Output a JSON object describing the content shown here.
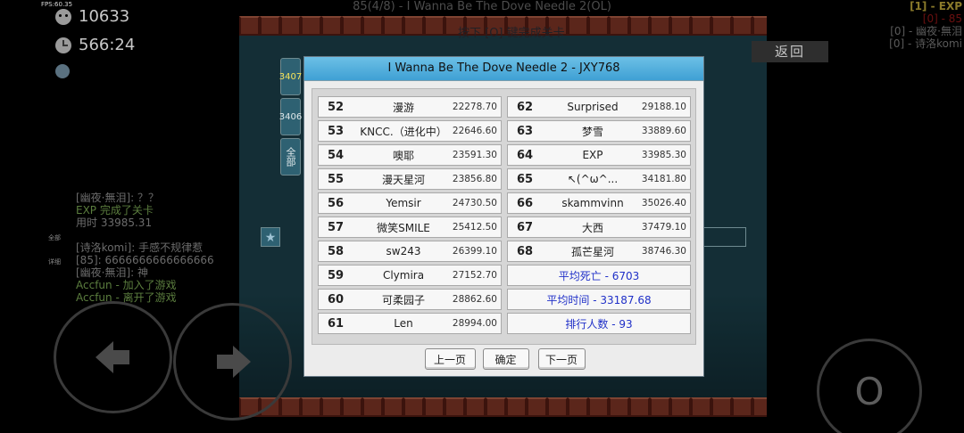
{
  "hud": {
    "fps": "FPS:60.35",
    "deaths": "10633",
    "time": "566:24"
  },
  "top_title": "85(4/8) - I Wanna Be The Dove Needle 2(OL)",
  "world_hint": "按下 [O] 键完成关卡",
  "right_list": [
    "[1] - EXP",
    "[0] - 85",
    "[0] - 幽夜·無泪",
    "[0] - 诗洛komi"
  ],
  "back_button": "返回",
  "chat": {
    "lines_a": [
      "[幽夜·無泪]: ？？",
      "EXP 完成了关卡",
      "用时 33985.31"
    ],
    "lines_b": [
      "[诗洛komi]: 手感不规律惹",
      "[85]: 6666666666666666",
      "[幽夜·無泪]: 神",
      "Accfun - 加入了游戏",
      "Accfun - 离开了游戏"
    ],
    "tag_all": "全部",
    "tag_detail": "详细"
  },
  "side_tabs": [
    "3407",
    "3406",
    "全部"
  ],
  "dialog": {
    "title": "I Wanna Be The Dove Needle 2 - JXY768",
    "left_rows": [
      {
        "rank": "52",
        "name": "漫游",
        "time": "22278.70"
      },
      {
        "rank": "53",
        "name": "KNCC.（进化中）",
        "time": "22646.60"
      },
      {
        "rank": "54",
        "name": "噢耶",
        "time": "23591.30"
      },
      {
        "rank": "55",
        "name": "漫天星河",
        "time": "23856.80"
      },
      {
        "rank": "56",
        "name": "Yemsir",
        "time": "24730.50"
      },
      {
        "rank": "57",
        "name": "微笑SMILE",
        "time": "25412.50"
      },
      {
        "rank": "58",
        "name": "sw243",
        "time": "26399.10"
      },
      {
        "rank": "59",
        "name": "Clymira",
        "time": "27152.70"
      },
      {
        "rank": "60",
        "name": "可柔园子",
        "time": "28862.60"
      },
      {
        "rank": "61",
        "name": "Len",
        "time": "28994.00"
      }
    ],
    "right_rows": [
      {
        "rank": "62",
        "name": "Surprised",
        "time": "29188.10"
      },
      {
        "rank": "63",
        "name": "梦雪",
        "time": "33889.60"
      },
      {
        "rank": "64",
        "name": "EXP",
        "time": "33985.30"
      },
      {
        "rank": "65",
        "name": "↖(^ω^...",
        "time": "34181.80"
      },
      {
        "rank": "66",
        "name": "skammvinn",
        "time": "35026.40"
      },
      {
        "rank": "67",
        "name": "大西",
        "time": "37479.10"
      },
      {
        "rank": "68",
        "name": "孤芒星河",
        "time": "38746.30"
      }
    ],
    "stats": {
      "avg_deaths": "平均死亡 - 6703",
      "avg_time": "平均时间 - 33187.68",
      "players": "排行人数 - 93"
    },
    "buttons": {
      "prev": "上一页",
      "ok": "确定",
      "next": "下一页"
    }
  },
  "controls": {
    "jump_label": "O"
  },
  "colors": {
    "title_bar": "#3fa0d4",
    "stat_text": "#2030c8",
    "brick": "#8c3b2a",
    "world_bg": "#1f4854"
  }
}
